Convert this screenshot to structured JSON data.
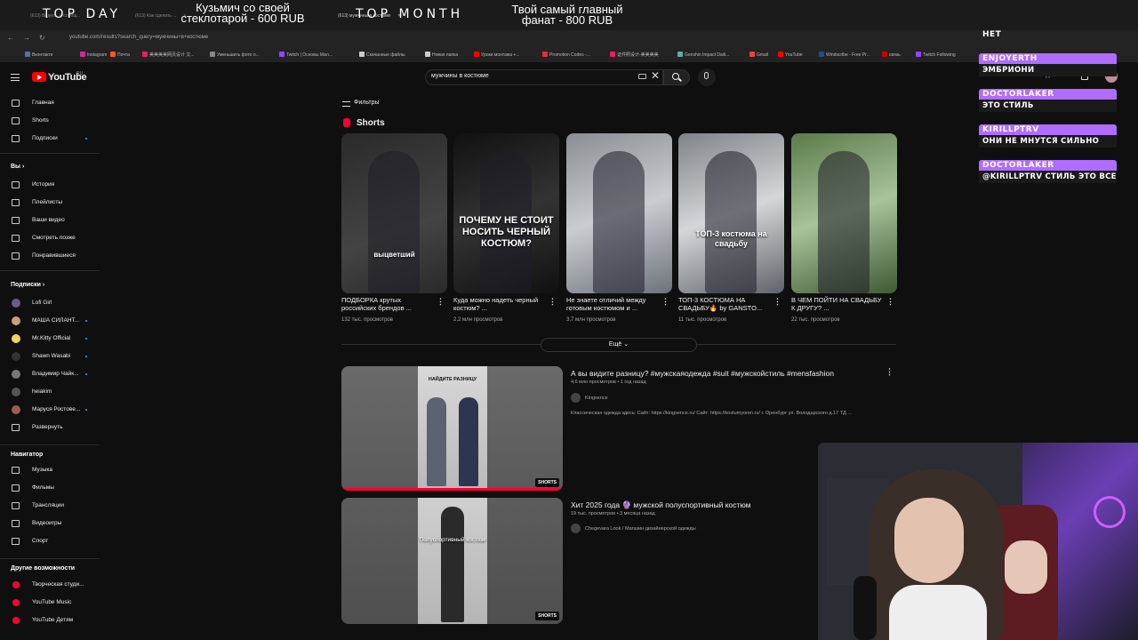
{
  "stream_overlay": {
    "top_day_label": "TOP DAY",
    "top_day_text_line1": "Кузьмич со своей",
    "top_day_text_line2": "стеклотарой - 600 RUB",
    "top_month_label": "TOP MONTH",
    "top_month_text_line1": "Твой самый главный",
    "top_month_text_line2": "фанат - 800 RUB"
  },
  "browser": {
    "url": "youtube.com/results?search_query=мужчины+в+костюме",
    "bookmarks": [
      "Вконтакте",
      "Instagram",
      "Почта",
      "美美美美网页设计 文...",
      "Уменьшить фото о...",
      "Twitch | Основы Мал...",
      "Скачанные файлы",
      "Новая папка",
      "Уроки монтажа +...",
      "Promotion Codes -...",
      "证件照设计-美美美美",
      "Genshin Impact Daili...",
      "Gmail",
      "YouTube",
      "Windscribe - Free Pr...",
      "связь",
      "Twitch Following"
    ]
  },
  "header": {
    "logo_text": "YouTube",
    "logo_region": "RU",
    "search_value": "мужчины в костюме",
    "create_label": "Создать",
    "notif_count": "9+"
  },
  "sidebar": {
    "main": [
      "Главная",
      "Shorts",
      "Подписки"
    ],
    "you_heading": "Вы",
    "you": [
      "История",
      "Плейлисты",
      "Ваши видео",
      "Смотреть позже",
      "Понравившиеся"
    ],
    "subs_heading": "Подписки",
    "subs": [
      "Lofi Girl",
      "МАША СИЛАНТ...",
      "Mr.Kitty Official",
      "Shawn Wasabi",
      "Владимир Чайк...",
      "heiakim",
      "Маруся Ростове...",
      "Развернуть"
    ],
    "nav_heading": "Навигатор",
    "nav": [
      "Музыка",
      "Фильмы",
      "Трансляции",
      "Видеоигры",
      "Спорт"
    ],
    "other_heading": "Другие возможности",
    "other": [
      "Творческая студи...",
      "YouTube Music",
      "YouTube Детям"
    ]
  },
  "main": {
    "filters_label": "Фильтры",
    "shorts_heading": "Shorts",
    "shorts": [
      {
        "title": "ПОДБОРКА крутых российских брендов ...",
        "views": "132 тыс. просмотров",
        "caption": "выцветший"
      },
      {
        "title": "Куда можно надеть черный костюм? ...",
        "views": "2,2 млн просмотров",
        "caption": "ПОЧЕМУ НЕ СТОИТ НОСИТЬ ЧЕРНЫЙ КОСТЮМ?"
      },
      {
        "title": "Не знаете отличий между готовым костюмом и ...",
        "views": "3,7 млн просмотров",
        "caption": ""
      },
      {
        "title": "ТОП-3 КОСТЮМА НА СВАДЬБУ🔥 by GANSTO...",
        "views": "11 тыс. просмотров",
        "caption": "ТОП-3 костюма на свадьбу"
      },
      {
        "title": "В ЧЕМ ПОЙТИ НА СВАДЬБУ К ДРУГУ? ...",
        "views": "22 тыс. просмотров",
        "caption": ""
      }
    ],
    "more_label": "Ещё",
    "videos": [
      {
        "title": "А вы видите разницу? #мужскаяодежда #suit #мужскойстиль #mensfashion",
        "meta": "4,6 млн просмотров • 1 год назад",
        "channel": "Kingsence",
        "description": "Классическая одежда здесь: Сайт: https://kingsence.ru/ Сайт: https://kostumyoren.ru/ г. Оренбург ул. Володарского д.17 ТД ...",
        "badge": "SHORTS",
        "thumb_text": "НАЙДИТЕ РАЗНИЦУ"
      },
      {
        "title": "Хит 2025 года 🔮 мужской полуспортивный костюм",
        "meta": "19 тыс. просмотров • 3 месяца назад",
        "channel": "Chegevara Look / Магазин дизайнерской одежды",
        "description": "",
        "badge": "SHORTS",
        "thumb_text": "Полуспортивный костюм"
      }
    ]
  },
  "chat": [
    {
      "name": "НЕТ",
      "message": ""
    },
    {
      "name": "ENJOYERTH",
      "message": "ЭМБРИОНИ"
    },
    {
      "name": "DOCTORLAKER",
      "message": "ЭТО СТИЛЬ"
    },
    {
      "name": "KIRILLPTRV",
      "message": "ОНИ НЕ МНУТСЯ СИЛЬНО"
    },
    {
      "name": "DOCTORLAKER",
      "message": "@KIRILLPTRV СТИЛЬ ЭТО ВСЕ"
    }
  ],
  "colors": {
    "accent": "#ff0000",
    "chat_name_bg": "#b06cff",
    "background": "#0f0f0f"
  }
}
